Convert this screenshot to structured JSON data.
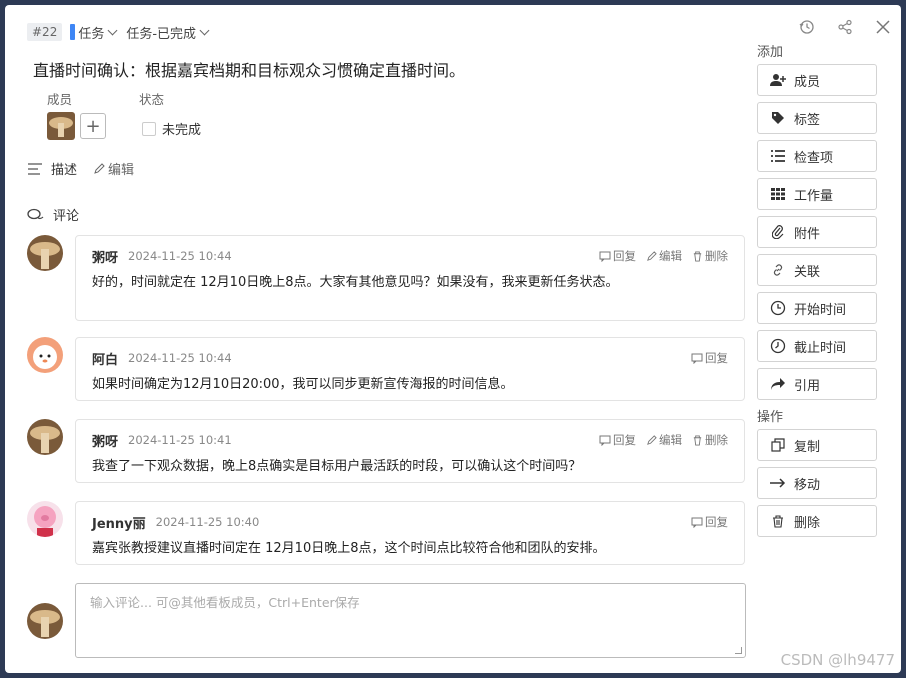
{
  "header": {
    "task_id": "#22",
    "type_label": "任务",
    "list_label": "任务-已完成"
  },
  "task": {
    "title": "直播时间确认：根据嘉宾档期和目标观众习惯确定直播时间。",
    "members_label": "成员",
    "status_label": "状态",
    "status_value": "未完成",
    "description_label": "描述",
    "edit_label": "编辑",
    "comments_label": "评论"
  },
  "comments": [
    {
      "author": "粥呀",
      "time": "2024-11-25 10:44",
      "text": "好的，时间就定在 12月10日晚上8点。大家有其他意见吗？如果没有，我来更新任务状态。",
      "reply": "回复",
      "edit": "编辑",
      "delete": "删除"
    },
    {
      "author": "阿白",
      "time": "2024-11-25 10:44",
      "text": "如果时间确定为12月10日20:00，我可以同步更新宣传海报的时间信息。",
      "reply": "回复"
    },
    {
      "author": "粥呀",
      "time": "2024-11-25 10:41",
      "text": "我查了一下观众数据，晚上8点确实是目标用户最活跃的时段，可以确认这个时间吗？",
      "reply": "回复",
      "edit": "编辑",
      "delete": "删除"
    },
    {
      "author": "Jenny丽",
      "time": "2024-11-25 10:40",
      "text": "嘉宾张教授建议直播时间定在 12月10日晚上8点，这个时间点比较符合他和团队的安排。",
      "reply": "回复"
    }
  ],
  "comment_input": {
    "placeholder": "输入评论... 可@其他看板成员，Ctrl+Enter保存"
  },
  "sidebar": {
    "add_label": "添加",
    "add_items": [
      "成员",
      "标签",
      "检查项",
      "工作量",
      "附件",
      "关联",
      "开始时间",
      "截止时间",
      "引用"
    ],
    "ops_label": "操作",
    "ops_items": [
      "复制",
      "移动",
      "删除"
    ]
  },
  "watermark": "CSDN @lh9477",
  "colors": {
    "type_accent": "#3e86f5"
  }
}
